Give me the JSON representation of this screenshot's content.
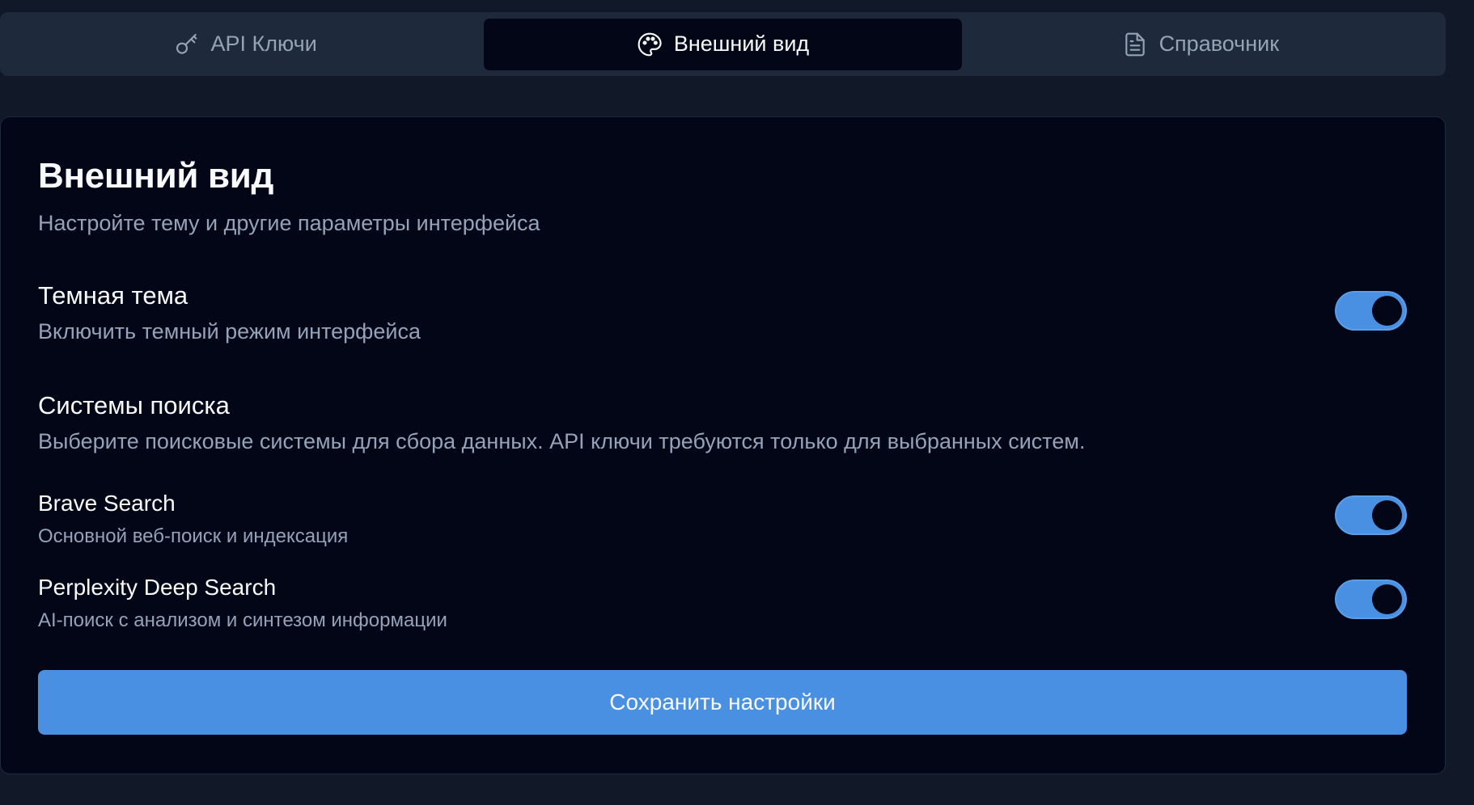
{
  "tabs": [
    {
      "label": "API Ключи",
      "icon": "key-icon",
      "active": false
    },
    {
      "label": "Внешний вид",
      "icon": "palette-icon",
      "active": true
    },
    {
      "label": "Справочник",
      "icon": "document-icon",
      "active": false
    }
  ],
  "card": {
    "title": "Внешний вид",
    "description": "Настройте тему и другие параметры интерфейса"
  },
  "dark_theme": {
    "title": "Темная тема",
    "description": "Включить темный режим интерфейса",
    "enabled": true
  },
  "search_systems": {
    "title": "Системы поиска",
    "description": "Выберите поисковые системы для сбора данных. API ключи требуются только для выбранных систем.",
    "engines": [
      {
        "name": "Brave Search",
        "description": "Основной веб-поиск и индексация",
        "enabled": true
      },
      {
        "name": "Perplexity Deep Search",
        "description": "AI-поиск с анализом и синтезом информации",
        "enabled": true
      }
    ]
  },
  "save_label": "Сохранить настройки",
  "colors": {
    "accent": "#4a90e2",
    "background": "#111827",
    "card": "#020617",
    "tab_bar": "#1e293b",
    "muted_text": "#94a3b8"
  }
}
